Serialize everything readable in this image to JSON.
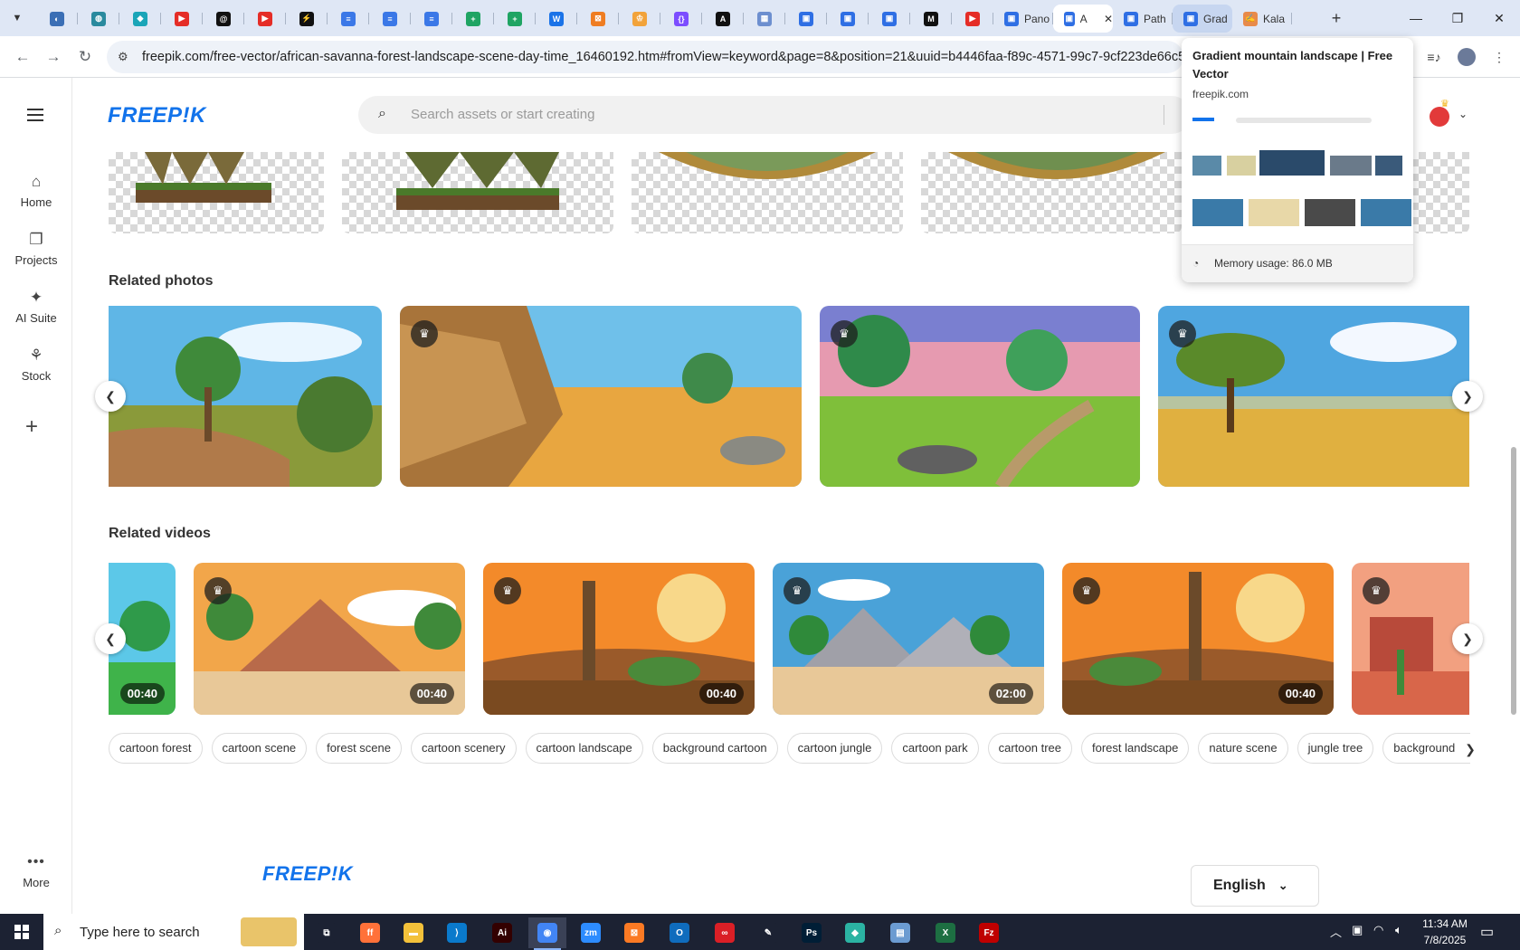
{
  "browser": {
    "tabs": [
      {
        "icon": "globe-icon",
        "color": "#3b6fb5",
        "glyph": "◐",
        "label": ""
      },
      {
        "icon": "web-icon",
        "color": "#2a8a9e",
        "glyph": "◍",
        "label": ""
      },
      {
        "icon": "ai-icon",
        "color": "#1aa5b8",
        "glyph": "◆",
        "label": ""
      },
      {
        "icon": "youtube-icon",
        "color": "#e52d27",
        "glyph": "▶",
        "label": ""
      },
      {
        "icon": "threads-icon",
        "color": "#111111",
        "glyph": "@",
        "label": ""
      },
      {
        "icon": "youtube-icon",
        "color": "#e52d27",
        "glyph": "▶",
        "label": ""
      },
      {
        "icon": "bolt-icon",
        "color": "#111111",
        "glyph": "⚡",
        "label": ""
      },
      {
        "icon": "docs-icon",
        "color": "#3b78e7",
        "glyph": "≡",
        "label": ""
      },
      {
        "icon": "docs-icon",
        "color": "#3b78e7",
        "glyph": "≡",
        "label": ""
      },
      {
        "icon": "docs-icon",
        "color": "#3b78e7",
        "glyph": "≡",
        "label": ""
      },
      {
        "icon": "sheets-icon",
        "color": "#1fa463",
        "glyph": "+",
        "label": ""
      },
      {
        "icon": "sheets-icon",
        "color": "#1fa463",
        "glyph": "+",
        "label": ""
      },
      {
        "icon": "word-icon",
        "color": "#1a73e8",
        "glyph": "W",
        "label": ""
      },
      {
        "icon": "xampp-icon",
        "color": "#ef7d22",
        "glyph": "⊠",
        "label": ""
      },
      {
        "icon": "crown-icon",
        "color": "#f2a33a",
        "glyph": "♔",
        "label": ""
      },
      {
        "icon": "code-icon",
        "color": "#7c4dff",
        "glyph": "{}",
        "label": ""
      },
      {
        "icon": "adobe-icon",
        "color": "#111111",
        "glyph": "A",
        "label": ""
      },
      {
        "icon": "grid-icon",
        "color": "#6d8fcf",
        "glyph": "▦",
        "label": ""
      },
      {
        "icon": "forms-icon",
        "color": "#2f6fe4",
        "glyph": "▣",
        "label": ""
      },
      {
        "icon": "forms-icon",
        "color": "#2f6fe4",
        "glyph": "▣",
        "label": ""
      },
      {
        "icon": "forms-icon",
        "color": "#2f6fe4",
        "glyph": "▣",
        "label": ""
      },
      {
        "icon": "medium-icon",
        "color": "#111111",
        "glyph": "M",
        "label": ""
      },
      {
        "icon": "youtube-icon",
        "color": "#e52d27",
        "glyph": "▶",
        "label": ""
      },
      {
        "icon": "forms-icon",
        "color": "#2f6fe4",
        "glyph": "▣",
        "label": "Pano"
      },
      {
        "icon": "forms-icon",
        "color": "#2f6fe4",
        "glyph": "▣",
        "label": "A"
      },
      {
        "icon": "forms-icon",
        "color": "#2f6fe4",
        "glyph": "▣",
        "label": "Path"
      },
      {
        "icon": "forms-icon",
        "color": "#2f6fe4",
        "glyph": "▣",
        "label": "Grad"
      },
      {
        "icon": "kalam-icon",
        "color": "#e88a4a",
        "glyph": "✍",
        "label": "Kala"
      }
    ],
    "active_tab_index": 24,
    "hover_tab_index": 26,
    "url": "freepik.com/free-vector/african-savanna-forest-landscape-scene-day-time_16460192.htm#fromView=keyword&page=8&position=21&uuid=b4446faa-f89c-4571-99c7-9cf223de66c5&qu",
    "close_glyph": "✕",
    "new_tab_glyph": "+"
  },
  "tab_preview": {
    "title": "Gradient mountain landscape | Free Vector",
    "domain": "freepik.com",
    "memory": "Memory usage: 86.0 MB"
  },
  "sidebar": {
    "items": [
      {
        "label": "Home",
        "icon": "home-icon",
        "glyph": "⌂"
      },
      {
        "label": "Projects",
        "icon": "projects-icon",
        "glyph": "❐"
      },
      {
        "label": "AI Suite",
        "icon": "sparkle-icon",
        "glyph": "✦"
      },
      {
        "label": "Stock",
        "icon": "stock-icon",
        "glyph": "⚘"
      }
    ],
    "plus_glyph": "+",
    "more_label": "More",
    "more_glyph": "•••"
  },
  "header": {
    "logo": "FREEP!K",
    "search_placeholder": "Search assets or start creating"
  },
  "related_photos": {
    "title": "Related photos"
  },
  "related_videos": {
    "title": "Related videos",
    "durations": [
      "00:40",
      "00:40",
      "00:40",
      "02:00",
      "00:40"
    ]
  },
  "tags": [
    "cartoon forest",
    "cartoon scene",
    "forest scene",
    "cartoon scenery",
    "cartoon landscape",
    "background cartoon",
    "cartoon jungle",
    "cartoon park",
    "cartoon tree",
    "forest landscape",
    "nature scene",
    "jungle tree",
    "background forest"
  ],
  "footer": {
    "logo": "FREEP!K",
    "language": "English"
  },
  "taskbar": {
    "search_text": "Type here to search",
    "time": "11:34 AM",
    "date": "7/8/2025",
    "apps": [
      {
        "icon": "task-view-icon",
        "color": "#1c2233",
        "glyph": "⧉"
      },
      {
        "icon": "firefox-icon",
        "color": "#ff7139",
        "glyph": "ff"
      },
      {
        "icon": "file-explorer-icon",
        "color": "#f3c13a",
        "glyph": "▬"
      },
      {
        "icon": "vscode-icon",
        "color": "#0a7acc",
        "glyph": "⟩"
      },
      {
        "icon": "illustrator-icon",
        "color": "#330000",
        "glyph": "Ai"
      },
      {
        "icon": "chrome-icon",
        "color": "#4285f4",
        "glyph": "◉"
      },
      {
        "icon": "zoom-icon",
        "color": "#2d8cff",
        "glyph": "zm"
      },
      {
        "icon": "xampp-icon",
        "color": "#fb7a24",
        "glyph": "⊠"
      },
      {
        "icon": "outlook-icon",
        "color": "#0f6cbd",
        "glyph": "O"
      },
      {
        "icon": "creative-cloud-icon",
        "color": "#da1f26",
        "glyph": "∞"
      },
      {
        "icon": "pen-icon",
        "color": "#1c2233",
        "glyph": "✎"
      },
      {
        "icon": "photoshop-icon",
        "color": "#001e36",
        "glyph": "Ps"
      },
      {
        "icon": "vpn-icon",
        "color": "#2bb3a3",
        "glyph": "◆"
      },
      {
        "icon": "notes-icon",
        "color": "#6b9bd1",
        "glyph": "▤"
      },
      {
        "icon": "excel-icon",
        "color": "#1d6f42",
        "glyph": "X"
      },
      {
        "icon": "filezilla-icon",
        "color": "#bf0000",
        "glyph": "Fz"
      }
    ],
    "active_app_index": 5
  }
}
